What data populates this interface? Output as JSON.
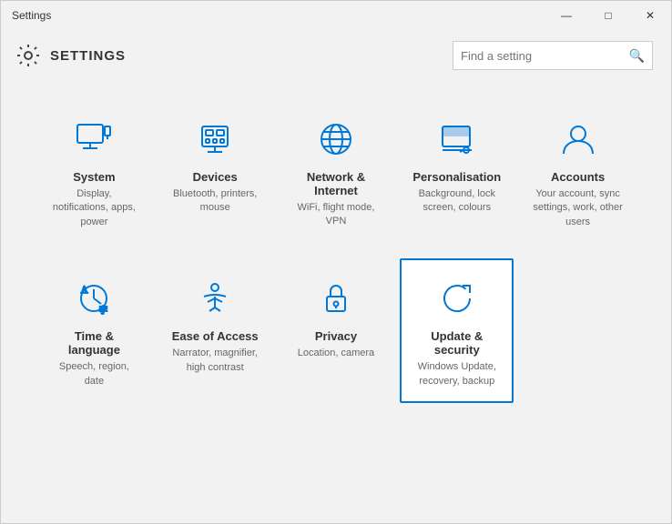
{
  "window": {
    "title": "Settings",
    "controls": {
      "minimize": "—",
      "maximize": "□",
      "close": "✕"
    }
  },
  "header": {
    "title": "SETTINGS",
    "search_placeholder": "Find a setting"
  },
  "tiles": [
    {
      "id": "system",
      "title": "System",
      "desc": "Display, notifications, apps, power",
      "icon": "system"
    },
    {
      "id": "devices",
      "title": "Devices",
      "desc": "Bluetooth, printers, mouse",
      "icon": "devices"
    },
    {
      "id": "network",
      "title": "Network & Internet",
      "desc": "WiFi, flight mode, VPN",
      "icon": "network"
    },
    {
      "id": "personalisation",
      "title": "Personalisation",
      "desc": "Background, lock screen, colours",
      "icon": "personalisation"
    },
    {
      "id": "accounts",
      "title": "Accounts",
      "desc": "Your account, sync settings, work, other users",
      "icon": "accounts"
    },
    {
      "id": "time",
      "title": "Time & language",
      "desc": "Speech, region, date",
      "icon": "time"
    },
    {
      "id": "ease",
      "title": "Ease of Access",
      "desc": "Narrator, magnifier, high contrast",
      "icon": "ease"
    },
    {
      "id": "privacy",
      "title": "Privacy",
      "desc": "Location, camera",
      "icon": "privacy"
    },
    {
      "id": "update",
      "title": "Update & security",
      "desc": "Windows Update, recovery, backup",
      "icon": "update",
      "active": true
    }
  ],
  "colors": {
    "accent": "#0078d7",
    "icon_stroke": "#0078d7"
  }
}
